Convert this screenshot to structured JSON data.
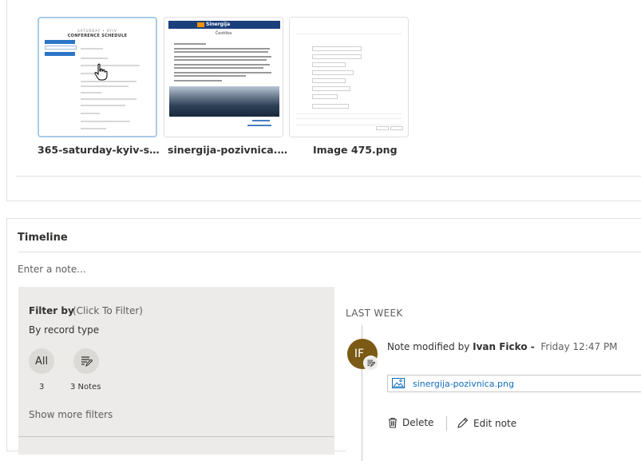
{
  "attachments": {
    "files": [
      {
        "name": "365-saturday-kyiv-sche...",
        "icon": "pdf-thumbnail"
      },
      {
        "name": "sinergija-pozivnica.png",
        "icon": "png-thumbnail"
      },
      {
        "name": "Image 475.png",
        "icon": "png-thumbnail"
      }
    ],
    "thumb1": {
      "small_header": "SATURDAY • KYIV",
      "title": "CONFERENCE SCHEDULE"
    },
    "thumb2": {
      "brand": "Sinergija",
      "subtitle": "Čestitka"
    }
  },
  "timeline": {
    "title": "Timeline",
    "note_placeholder": "Enter a note...",
    "filter": {
      "label": "Filter by",
      "hint": "(Click To Filter)",
      "record_type_label": "By record type",
      "all_label": "All",
      "all_count": "3",
      "notes_count_label": "3 Notes",
      "show_more": "Show more filters"
    },
    "activity": {
      "period": "LAST WEEK",
      "avatar_initials": "IF",
      "action": "Note modified by",
      "author": "Ivan Ficko -",
      "time": "Friday 12:47 PM",
      "attachment_name": "sinergija-pozivnica.png",
      "delete_label": "Delete",
      "edit_label": "Edit note"
    }
  },
  "colors": {
    "accent_link": "#0f6cbd",
    "avatar_bg": "#7a5a14",
    "filter_pane_bg": "#edebe9"
  }
}
